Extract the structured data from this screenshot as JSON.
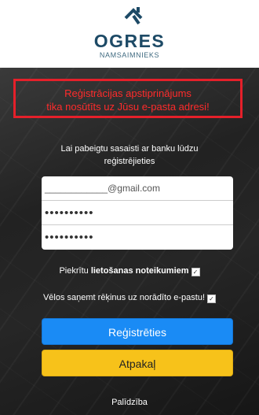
{
  "brand": {
    "name": "OGRES",
    "subtitle": "NAMSAIMNIEKS",
    "logo_icon": "house-roof-logo-icon"
  },
  "alert": {
    "line1": "Reģistrācijas apstiprinājums",
    "line2": "tika nosūtīts uz Jūsu e-pasta adresi!",
    "color": "#e5202a"
  },
  "info": {
    "line1": "Lai pabeigtu sasaisti ar banku lūdzu",
    "line2": "reģistrējieties"
  },
  "form": {
    "email_value": "____________@gmail.com",
    "password_mask": "••••••••••",
    "password_repeat_mask": "••••••••••"
  },
  "terms": {
    "prefix": "Piekrītu ",
    "link": "lietošanas noteikumiem",
    "checked": true
  },
  "invoices": {
    "label": "Vēlos saņemt rēķinus uz norādīto e-pastu!",
    "checked": true
  },
  "buttons": {
    "register": "Reģistrēties",
    "back": "Atpakaļ",
    "register_color": "#1a8bf5",
    "back_color": "#f7c21a"
  },
  "help": {
    "label": "Palīdzība"
  }
}
